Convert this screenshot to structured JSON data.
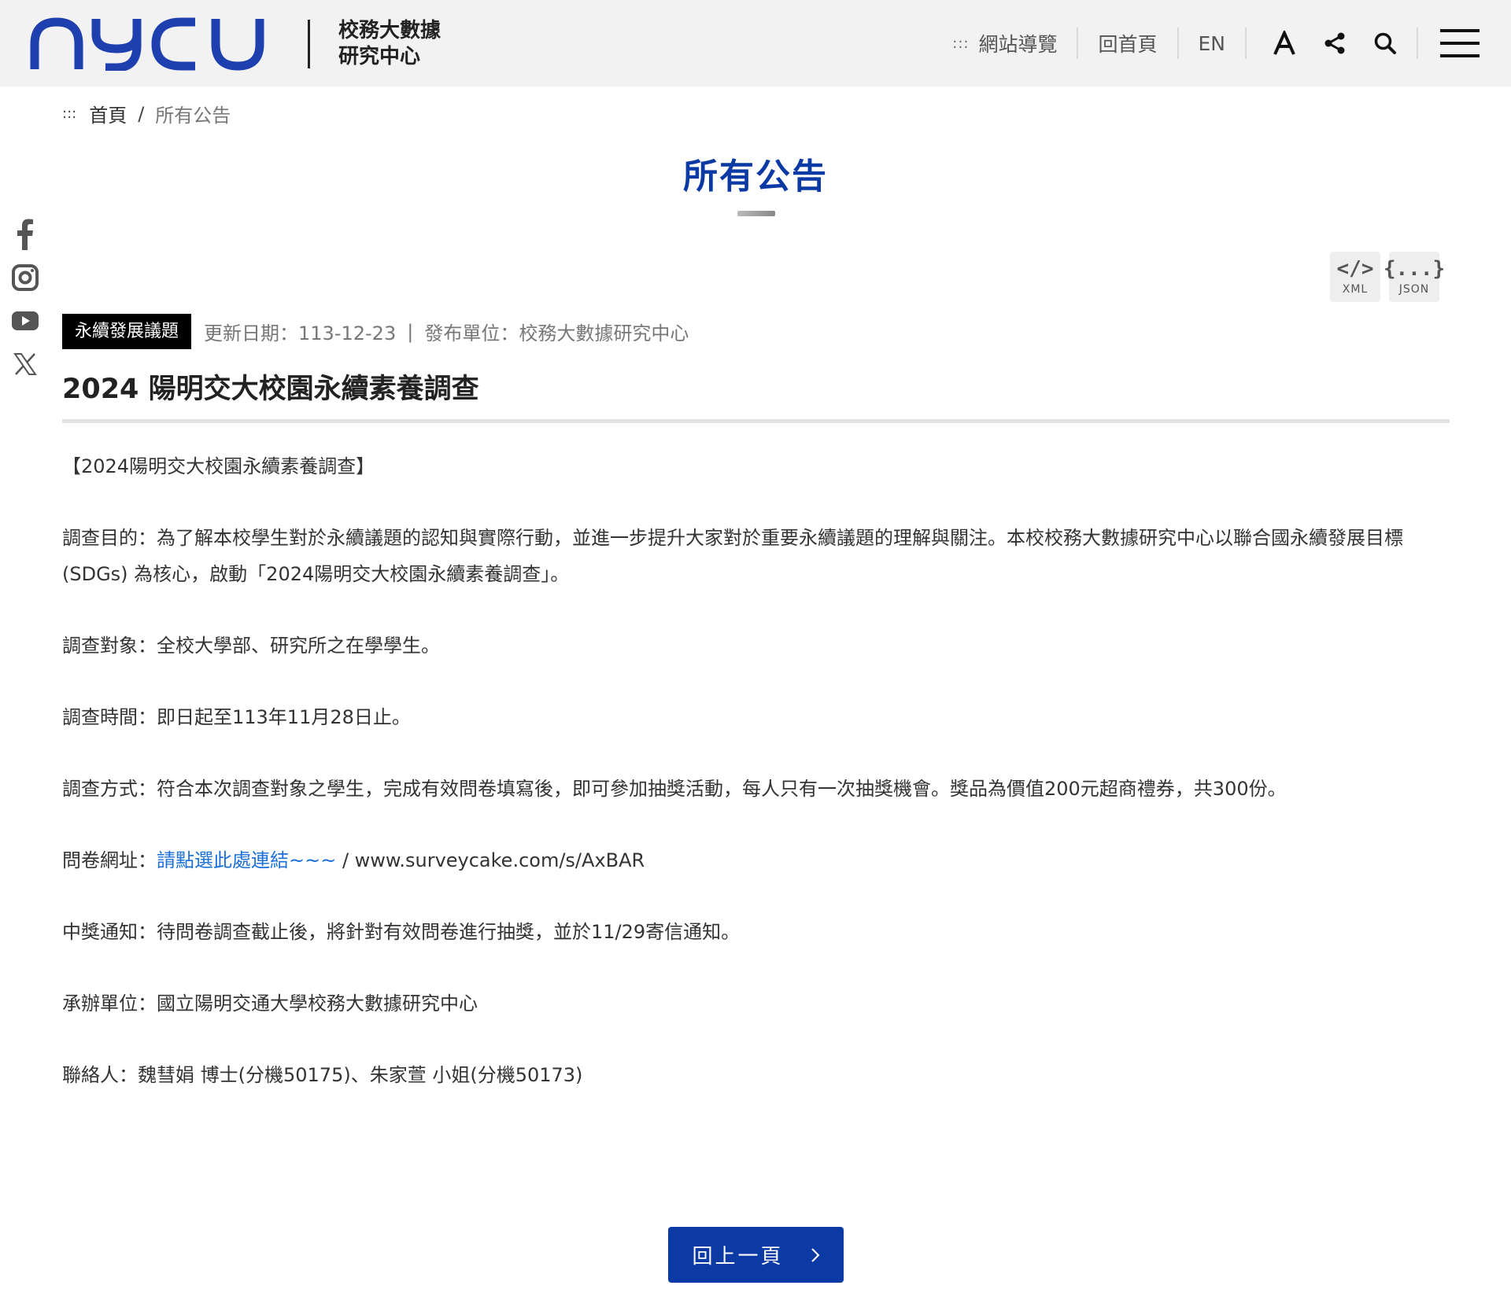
{
  "brand": {
    "logo_text": "nycu",
    "unit_line1": "校務大數據",
    "unit_line2": "研究中心",
    "brand_color": "#1e3fae"
  },
  "nav": {
    "sitemap_prefix": ":::",
    "sitemap": "網站導覽",
    "home": "回首頁",
    "lang": "EN",
    "icons": [
      "font-size-icon",
      "share-icon",
      "search-icon",
      "menu-icon"
    ]
  },
  "breadcrumb": {
    "prefix": ":::",
    "home": "首頁",
    "separator": "/",
    "current": "所有公告"
  },
  "page": {
    "title": "所有公告",
    "title_color": "#0b3aa4"
  },
  "social": [
    "facebook-icon",
    "instagram-icon",
    "youtube-icon",
    "x-icon"
  ],
  "feeds": {
    "xml_symbol": "</>",
    "xml_label": "XML",
    "json_symbol": "{...}",
    "json_label": "JSON"
  },
  "post": {
    "tag": "永續發展議題",
    "updated": "更新日期：113-12-23",
    "pipe": "|",
    "publisher": "發布單位：校務大數據研究中心",
    "title": "2024 陽明交大校園永續素養調查"
  },
  "article": {
    "heading": "【2024陽明交大校園永續素養調查】",
    "purpose": "調查目的：為了解本校學生對於永續議題的認知與實際行動，並進一步提升大家對於重要永續議題的理解與關注。本校校務大數據研究中心以聯合國永續發展目標 (SDGs) 為核心，啟動「2024陽明交大校園永續素養調查」。",
    "target": "調查對象：全校大學部、研究所之在學學生。",
    "period": "調查時間：即日起至113年11月28日止。",
    "method": "調查方式：符合本次調查對象之學生，完成有效問卷填寫後，即可參加抽獎活動，每人只有一次抽獎機會。獎品為價值200元超商禮券，共300份。",
    "url_label": "問卷網址：",
    "url_link": "請點選此處連結~~~",
    "url_text": " / www.surveycake.com/s/AxBAR",
    "notice": "中獎通知：待問卷調查截止後，將針對有效問卷進行抽獎，並於11/29寄信通知。",
    "organizer": "承辦單位：國立陽明交通大學校務大數據研究中心",
    "contact": "聯絡人：魏彗娟 博士(分機50175)、朱家萱 小姐(分機50173)"
  },
  "back_button": {
    "label": "回上一頁",
    "color": "#0b3aa4"
  }
}
